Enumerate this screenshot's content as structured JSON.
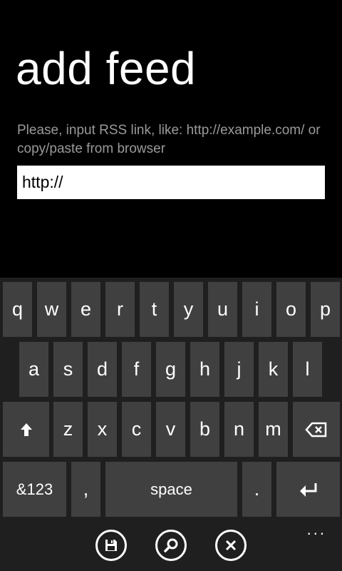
{
  "page": {
    "title": "add feed",
    "hint": "Please, input RSS link, like: http://example.com/ or copy/paste from browser"
  },
  "url_input": {
    "value": "http://"
  },
  "keyboard": {
    "row1": [
      "q",
      "w",
      "e",
      "r",
      "t",
      "y",
      "u",
      "i",
      "o",
      "p"
    ],
    "row2": [
      "a",
      "s",
      "d",
      "f",
      "g",
      "h",
      "j",
      "k",
      "l"
    ],
    "row3": [
      "z",
      "x",
      "c",
      "v",
      "b",
      "n",
      "m"
    ],
    "symbols_label": "&123",
    "comma_label": ",",
    "space_label": "space",
    "period_label": ".",
    "shift_icon": "shift-arrow-icon",
    "backspace_icon": "backspace-icon",
    "enter_icon": "enter-icon"
  },
  "appbar": {
    "buttons": [
      {
        "icon": "save-icon"
      },
      {
        "icon": "search-icon"
      },
      {
        "icon": "close-icon"
      }
    ],
    "more_label": "..."
  }
}
